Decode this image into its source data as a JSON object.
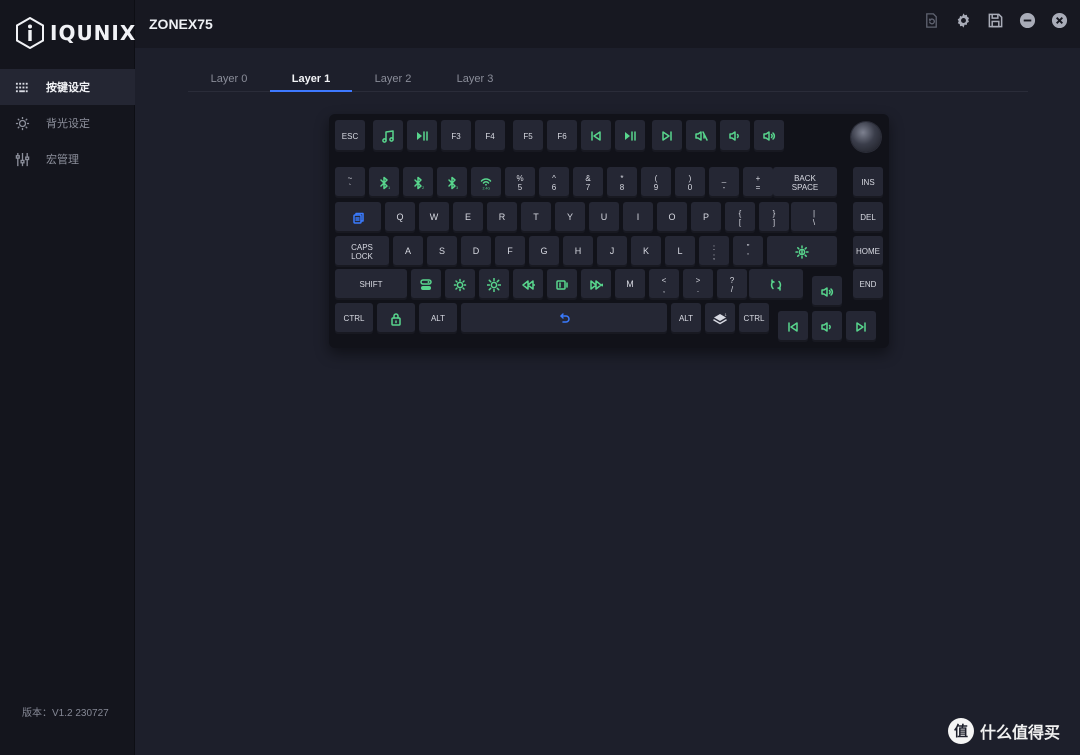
{
  "app": {
    "brand": "IQUNIX",
    "device": "ZONEX75",
    "version": "版本：V1.2 230727"
  },
  "sidebar": {
    "items": [
      {
        "label": "按键设定",
        "icon": "keyboard-grid-icon",
        "active": true
      },
      {
        "label": "背光设定",
        "icon": "light-gear-icon",
        "active": false
      },
      {
        "label": "宏管理",
        "icon": "sliders-icon",
        "active": false
      }
    ]
  },
  "window_controls": [
    "reset-icon",
    "settings-gear-icon",
    "save-icon",
    "minimize-icon",
    "close-icon"
  ],
  "tabs": [
    {
      "label": "Layer 0",
      "active": false
    },
    {
      "label": "Layer 1",
      "active": true
    },
    {
      "label": "Layer 2",
      "active": false
    },
    {
      "label": "Layer 3",
      "active": false
    }
  ],
  "colors": {
    "accent": "#3d78ff",
    "green_key": "#58d68d",
    "blue_key": "#3a7bff"
  },
  "watermark": {
    "text": "什么值得买",
    "logo": "值"
  },
  "keys": [
    {
      "id": "esc",
      "label": "ESC"
    },
    {
      "id": "f1",
      "icon": "music-note-icon",
      "color": "green"
    },
    {
      "id": "f2",
      "icon": "play-pause-icon",
      "color": "green"
    },
    {
      "id": "f3",
      "label": "F3"
    },
    {
      "id": "f4",
      "label": "F4"
    },
    {
      "id": "f5",
      "label": "F5"
    },
    {
      "id": "f6",
      "label": "F6"
    },
    {
      "id": "f7",
      "icon": "prev-track-icon",
      "color": "green"
    },
    {
      "id": "f8",
      "icon": "play-pause-icon",
      "color": "green"
    },
    {
      "id": "f9",
      "icon": "next-track-icon",
      "color": "green"
    },
    {
      "id": "f10",
      "icon": "mute-icon",
      "color": "green"
    },
    {
      "id": "f11",
      "icon": "volume-down-icon",
      "color": "green"
    },
    {
      "id": "f12",
      "icon": "volume-up-icon",
      "color": "green"
    },
    {
      "id": "grave",
      "label": "~\n`"
    },
    {
      "id": "n1",
      "icon": "bluetooth-1-icon",
      "color": "green"
    },
    {
      "id": "n2",
      "icon": "bluetooth-2-icon",
      "color": "green"
    },
    {
      "id": "n3",
      "icon": "bluetooth-3-icon",
      "color": "green"
    },
    {
      "id": "n4",
      "icon": "wireless-24g-icon",
      "color": "green"
    },
    {
      "id": "n5",
      "label": "%\n5"
    },
    {
      "id": "n6",
      "label": "^\n6"
    },
    {
      "id": "n7",
      "label": "&\n7"
    },
    {
      "id": "n8",
      "label": "*\n8"
    },
    {
      "id": "n9",
      "label": "(\n9"
    },
    {
      "id": "n0",
      "label": ")\n0"
    },
    {
      "id": "minus",
      "label": "_\n-"
    },
    {
      "id": "equal",
      "label": "+\n="
    },
    {
      "id": "backspace",
      "label": "BACK\nSPACE"
    },
    {
      "id": "ins",
      "label": "INS"
    },
    {
      "id": "tab",
      "icon": "windows-lock-icon",
      "color": "blue"
    },
    {
      "id": "q",
      "label": "Q"
    },
    {
      "id": "w",
      "label": "W"
    },
    {
      "id": "e",
      "label": "E"
    },
    {
      "id": "r",
      "label": "R"
    },
    {
      "id": "t",
      "label": "T"
    },
    {
      "id": "y",
      "label": "Y"
    },
    {
      "id": "u",
      "label": "U"
    },
    {
      "id": "i",
      "label": "I"
    },
    {
      "id": "o",
      "label": "O"
    },
    {
      "id": "p",
      "label": "P"
    },
    {
      "id": "lbracket",
      "label": "{\n["
    },
    {
      "id": "rbracket",
      "label": "}\n]"
    },
    {
      "id": "backslash",
      "label": "|\n\\"
    },
    {
      "id": "del",
      "label": "DEL"
    },
    {
      "id": "caps",
      "label": "CAPS\nLOCK"
    },
    {
      "id": "a",
      "label": "A"
    },
    {
      "id": "s",
      "label": "S"
    },
    {
      "id": "d",
      "label": "D"
    },
    {
      "id": "f",
      "label": "F"
    },
    {
      "id": "g",
      "label": "G"
    },
    {
      "id": "h",
      "label": "H"
    },
    {
      "id": "j",
      "label": "J"
    },
    {
      "id": "k",
      "label": "K"
    },
    {
      "id": "l",
      "label": "L"
    },
    {
      "id": "semicolon",
      "label": ":\n;"
    },
    {
      "id": "quote",
      "label": "\"\n'"
    },
    {
      "id": "enter",
      "icon": "light-effect-icon",
      "color": "green"
    },
    {
      "id": "home",
      "label": "HOME"
    },
    {
      "id": "lshift",
      "label": "SHIFT"
    },
    {
      "id": "z",
      "icon": "toggle-switch-icon",
      "color": "green"
    },
    {
      "id": "x",
      "icon": "brightness-down-icon",
      "color": "green"
    },
    {
      "id": "c",
      "icon": "brightness-up-icon",
      "color": "green"
    },
    {
      "id": "v",
      "icon": "speed-down-icon",
      "color": "green"
    },
    {
      "id": "b",
      "icon": "backlight-mode-icon",
      "color": "green"
    },
    {
      "id": "n",
      "icon": "speed-up-icon",
      "color": "green"
    },
    {
      "id": "m",
      "label": "M"
    },
    {
      "id": "comma",
      "label": "<\n,"
    },
    {
      "id": "period",
      "label": ">\n."
    },
    {
      "id": "slash",
      "label": "?\n/"
    },
    {
      "id": "rshift",
      "icon": "cycle-icon",
      "color": "green"
    },
    {
      "id": "up",
      "icon": "volume-up-icon",
      "color": "green"
    },
    {
      "id": "end",
      "label": "END"
    },
    {
      "id": "lctrl",
      "label": "CTRL"
    },
    {
      "id": "lwin",
      "icon": "lock-icon",
      "color": "green"
    },
    {
      "id": "lalt",
      "label": "ALT"
    },
    {
      "id": "space",
      "icon": "undo-icon",
      "color": "blue"
    },
    {
      "id": "ralt",
      "label": "ALT"
    },
    {
      "id": "fn",
      "icon": "layer-1-icon",
      "color": "white"
    },
    {
      "id": "rctrl",
      "label": "CTRL"
    },
    {
      "id": "left",
      "icon": "prev-track-icon",
      "color": "green"
    },
    {
      "id": "down",
      "icon": "volume-down-icon",
      "color": "green"
    },
    {
      "id": "right",
      "icon": "next-track-icon",
      "color": "green"
    }
  ]
}
